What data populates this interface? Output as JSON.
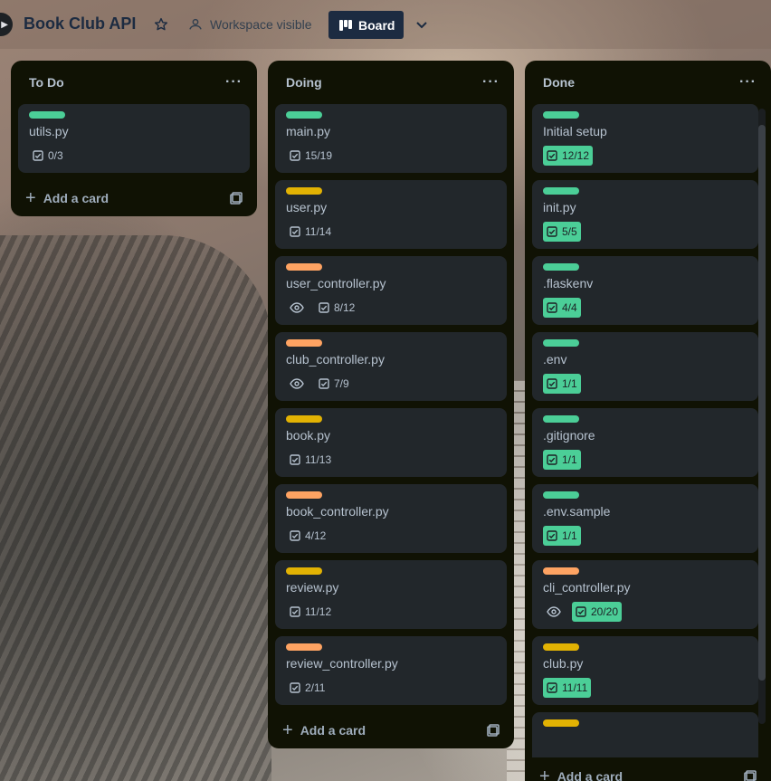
{
  "header": {
    "board_title": "Book Club API",
    "visibility_label": "Workspace visible",
    "view_label": "Board"
  },
  "colors": {
    "green": "#4bce97",
    "yellow": "#e2b203",
    "orange": "#fea362"
  },
  "lists": [
    {
      "title": "To Do",
      "add_card_label": "Add a card",
      "cards": [
        {
          "title": "utils.py",
          "label": "green",
          "checklist": "0/3",
          "complete": false,
          "watched": false
        }
      ]
    },
    {
      "title": "Doing",
      "add_card_label": "Add a card",
      "cards": [
        {
          "title": "main.py",
          "label": "green",
          "checklist": "15/19",
          "complete": false,
          "watched": false
        },
        {
          "title": "user.py",
          "label": "yellow",
          "checklist": "11/14",
          "complete": false,
          "watched": false
        },
        {
          "title": "user_controller.py",
          "label": "orange",
          "checklist": "8/12",
          "complete": false,
          "watched": true
        },
        {
          "title": "club_controller.py",
          "label": "orange",
          "checklist": "7/9",
          "complete": false,
          "watched": true
        },
        {
          "title": "book.py",
          "label": "yellow",
          "checklist": "11/13",
          "complete": false,
          "watched": false
        },
        {
          "title": "book_controller.py",
          "label": "orange",
          "checklist": "4/12",
          "complete": false,
          "watched": false
        },
        {
          "title": "review.py",
          "label": "yellow",
          "checklist": "11/12",
          "complete": false,
          "watched": false
        },
        {
          "title": "review_controller.py",
          "label": "orange",
          "checklist": "2/11",
          "complete": false,
          "watched": false
        }
      ]
    },
    {
      "title": "Done",
      "add_card_label": "Add a card",
      "cards": [
        {
          "title": "Initial setup",
          "label": "green",
          "checklist": "12/12",
          "complete": true,
          "watched": false
        },
        {
          "title": "init.py",
          "label": "green",
          "checklist": "5/5",
          "complete": true,
          "watched": false
        },
        {
          "title": ".flaskenv",
          "label": "green",
          "checklist": "4/4",
          "complete": true,
          "watched": false
        },
        {
          "title": ".env",
          "label": "green",
          "checklist": "1/1",
          "complete": true,
          "watched": false
        },
        {
          "title": ".gitignore",
          "label": "green",
          "checklist": "1/1",
          "complete": true,
          "watched": false
        },
        {
          "title": ".env.sample",
          "label": "green",
          "checklist": "1/1",
          "complete": true,
          "watched": false
        },
        {
          "title": "cli_controller.py",
          "label": "orange",
          "checklist": "20/20",
          "complete": true,
          "watched": true
        },
        {
          "title": "club.py",
          "label": "yellow",
          "checklist": "11/11",
          "complete": true,
          "watched": false
        },
        {
          "title": "",
          "label": "yellow",
          "checklist": "",
          "complete": true,
          "watched": false
        }
      ]
    }
  ]
}
